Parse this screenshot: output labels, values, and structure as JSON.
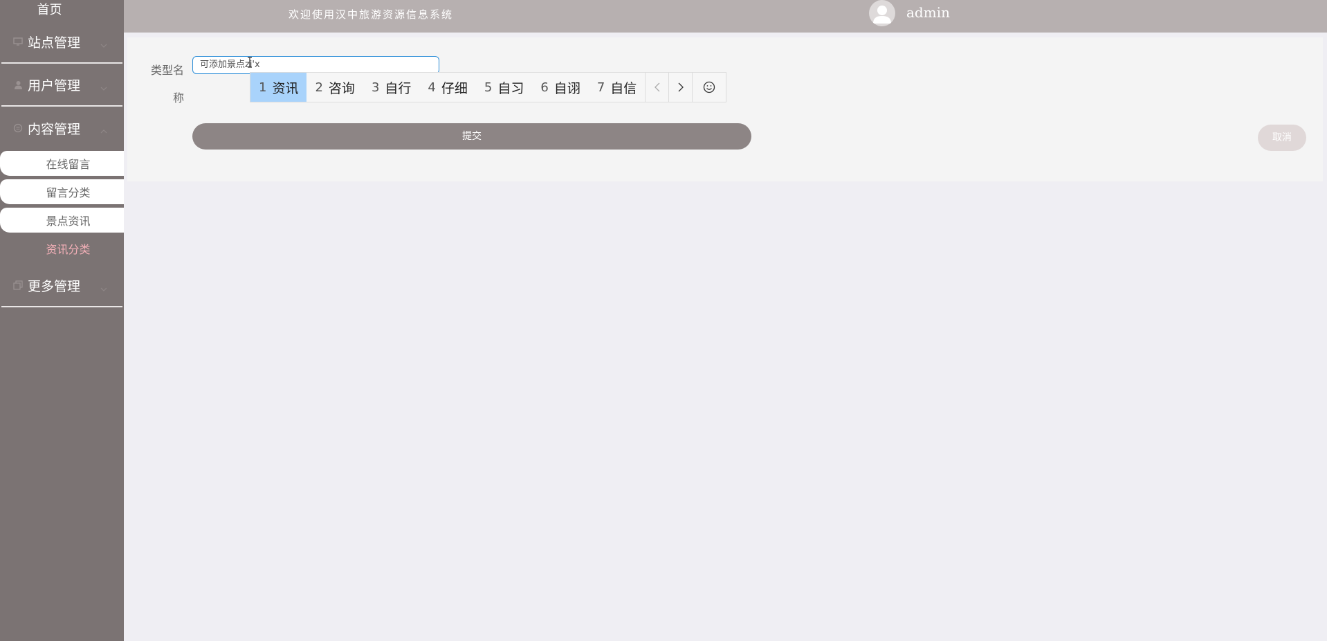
{
  "sidebar": {
    "home_label": "首页",
    "menus": [
      {
        "label": "站点管理",
        "icon": "monitor-icon"
      },
      {
        "label": "用户管理",
        "icon": "user-icon"
      },
      {
        "label": "内容管理",
        "icon": "message-icon"
      },
      {
        "label": "更多管理",
        "icon": "copy-icon"
      }
    ],
    "content_submenu": [
      {
        "label": "在线留言"
      },
      {
        "label": "留言分类"
      },
      {
        "label": "景点资讯"
      },
      {
        "label": "资讯分类",
        "active": true
      }
    ]
  },
  "header": {
    "welcome": "欢迎使用汉中旅游资源信息系统",
    "username": "admin"
  },
  "form": {
    "field_label": "类型名称",
    "field_label_line1": "类型名",
    "field_label_line2": "称",
    "input_value": "可添加景点zi'x",
    "submit_label": "提交",
    "cancel_label": "取消"
  },
  "ime": {
    "candidates": [
      {
        "num": "1",
        "text": "资讯",
        "selected": true
      },
      {
        "num": "2",
        "text": "咨询"
      },
      {
        "num": "3",
        "text": "自行"
      },
      {
        "num": "4",
        "text": "仔细"
      },
      {
        "num": "5",
        "text": "自习"
      },
      {
        "num": "6",
        "text": "自诩"
      },
      {
        "num": "7",
        "text": "自信"
      }
    ]
  },
  "colors": {
    "sidebar_bg": "#7b7373",
    "header_bg": "#b7b0b0",
    "active_submenu": "#f4b0b8",
    "submit_bg": "#8d8585",
    "ime_selected": "#a9d3fb"
  }
}
